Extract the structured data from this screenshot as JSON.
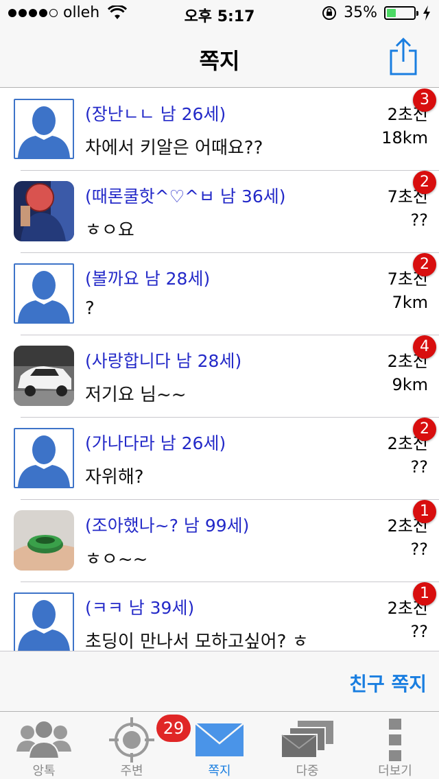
{
  "status_bar": {
    "carrier": "olleh",
    "time": "오후 5:17",
    "battery_percent": "35%",
    "battery_level": 0.35,
    "icons": [
      "signal-dots-icon",
      "wifi-icon",
      "rotation-lock-icon",
      "battery-icon",
      "charging-bolt-icon"
    ]
  },
  "nav": {
    "title": "쪽지",
    "share_icon": "share-icon"
  },
  "messages": [
    {
      "name": "(장난ㄴㄴ 남 26세)",
      "text": "차에서 키알은 어때요??",
      "time": "2초전",
      "distance": "18km",
      "badge": "3",
      "avatar": "default"
    },
    {
      "name": "(때론쿨핫^♡^ㅂ 남 36세)",
      "text": "ㅎㅇ요",
      "time": "7초전",
      "distance": "??",
      "badge": "2",
      "avatar": "photo-person"
    },
    {
      "name": "(볼까요 남 28세)",
      "text": "?",
      "time": "7초전",
      "distance": "7km",
      "badge": "2",
      "avatar": "default"
    },
    {
      "name": "(사랑합니다 남 28세)",
      "text": "저기요 님~~",
      "time": "2초전",
      "distance": "9km",
      "badge": "4",
      "avatar": "photo-car"
    },
    {
      "name": "(가나다라 남 26세)",
      "text": "자위해?",
      "time": "2초전",
      "distance": "??",
      "badge": "2",
      "avatar": "default"
    },
    {
      "name": "(조아했나~? 남 99세)",
      "text": "ㅎㅇ~~",
      "time": "2초전",
      "distance": "??",
      "badge": "1",
      "avatar": "photo-ring"
    },
    {
      "name": "(ㅋㅋ 남 39세)",
      "text": "초딩이 만나서 모하고싶어? ㅎ",
      "time": "2초전",
      "distance": "??",
      "badge": "1",
      "avatar": "default"
    }
  ],
  "action": {
    "friend_message": "친구 쪽지"
  },
  "tabs": [
    {
      "label": "앙톡",
      "icon": "people-icon"
    },
    {
      "label": "주변",
      "icon": "crosshair-icon"
    },
    {
      "label": "쪽지",
      "icon": "mail-icon",
      "badge": "29",
      "active": true
    },
    {
      "label": "다중",
      "icon": "multi-mail-icon"
    },
    {
      "label": "더보기",
      "icon": "more-icon"
    }
  ],
  "colors": {
    "accent": "#1a7ee0",
    "name_text": "#2329c8",
    "badge": "#d80e0e",
    "avatar_blue": "#3d73c8"
  }
}
